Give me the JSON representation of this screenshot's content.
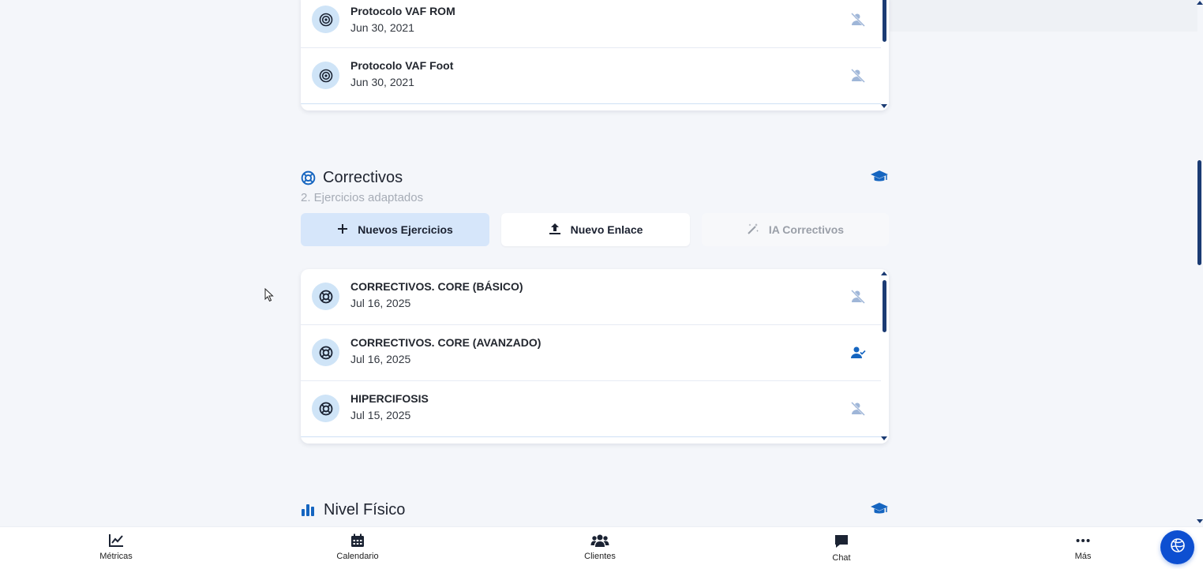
{
  "top_list": {
    "items": [
      {
        "title": "Protocolo VAF ROM",
        "date": "Jun 30, 2021",
        "icon": "target-icon",
        "action_icon": "person-off-icon"
      },
      {
        "title": "Protocolo VAF Foot",
        "date": "Jun 30, 2021",
        "icon": "target-icon",
        "action_icon": "person-off-icon"
      }
    ]
  },
  "correctivos": {
    "title": "Correctivos",
    "subtitle": "2. Ejercicios adaptados",
    "icon": "lifebuoy-icon",
    "buttons": {
      "new_exercises": "Nuevos Ejercicios",
      "new_link": "Nuevo Enlace",
      "ai": "IA Correctivos"
    },
    "items": [
      {
        "title": "CORRECTIVOS. CORE (BÁSICO)",
        "date": "Jul 16, 2025",
        "icon": "lifebuoy-icon",
        "action_icon": "person-off-icon"
      },
      {
        "title": "CORRECTIVOS. CORE (AVANZADO)",
        "date": "Jul 16, 2025",
        "icon": "lifebuoy-icon",
        "action_icon": "person-check-icon"
      },
      {
        "title": "HIPERCIFOSIS",
        "date": "Jul 15, 2025",
        "icon": "lifebuoy-icon",
        "action_icon": "person-off-icon"
      }
    ]
  },
  "nivel_fisico": {
    "title": "Nivel Físico",
    "icon": "bar-chart-icon"
  },
  "bottom_nav": {
    "items": [
      {
        "label": "Métricas",
        "icon": "line-chart-icon"
      },
      {
        "label": "Calendario",
        "icon": "calendar-icon"
      },
      {
        "label": "Clientes",
        "icon": "users-icon"
      },
      {
        "label": "Chat",
        "icon": "chat-icon"
      },
      {
        "label": "Más",
        "icon": "more-icon"
      }
    ]
  },
  "colors": {
    "accent": "#1565c0",
    "primary_button_bg": "#d6e6fa",
    "icon_circle_bg": "#cfe4f7",
    "scroll_thumb": "#1b3b73",
    "fab": "#0d4fd1"
  }
}
